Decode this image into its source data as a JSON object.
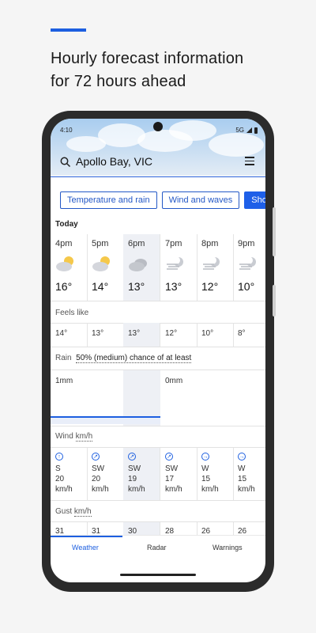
{
  "promo": {
    "headline_line1": "Hourly forecast information",
    "headline_line2": "for 72 hours ahead"
  },
  "status_bar": {
    "time": "4:10",
    "network": "5G"
  },
  "search": {
    "location": "Apollo Bay, VIC"
  },
  "chips": [
    {
      "label": "Temperature and rain"
    },
    {
      "label": "Wind and waves"
    },
    {
      "label": "Sho"
    }
  ],
  "day_label": "Today",
  "hours": [
    {
      "time": "4pm",
      "icon": "partly-sunny-icon",
      "temp": "16°"
    },
    {
      "time": "5pm",
      "icon": "partly-sunny-icon",
      "temp": "14°"
    },
    {
      "time": "6pm",
      "icon": "cloudy-icon",
      "temp": "13°"
    },
    {
      "time": "7pm",
      "icon": "hazy-moon-icon",
      "temp": "13°"
    },
    {
      "time": "8pm",
      "icon": "hazy-moon-icon",
      "temp": "12°"
    },
    {
      "time": "9pm",
      "icon": "hazy-moon-icon",
      "temp": "10°"
    }
  ],
  "feels_like": {
    "label": "Feels like",
    "values": [
      "14°",
      "13°",
      "13°",
      "12°",
      "10°",
      "8°"
    ]
  },
  "rain": {
    "label": "Rain",
    "chance": "50% (medium) chance of at least",
    "amount_first": "1mm",
    "amount_second": "0mm"
  },
  "wind": {
    "label": "Wind",
    "unit": "km/h",
    "cells": [
      {
        "dir": "S",
        "speed": "20",
        "unit": "km/h",
        "arrow": "↑"
      },
      {
        "dir": "SW",
        "speed": "20",
        "unit": "km/h",
        "arrow": "↗"
      },
      {
        "dir": "SW",
        "speed": "19",
        "unit": "km/h",
        "arrow": "↗"
      },
      {
        "dir": "SW",
        "speed": "17",
        "unit": "km/h",
        "arrow": "↗"
      },
      {
        "dir": "W",
        "speed": "15",
        "unit": "km/h",
        "arrow": "→"
      },
      {
        "dir": "W",
        "speed": "15",
        "unit": "km/h",
        "arrow": "→"
      }
    ]
  },
  "gust": {
    "label": "Gust",
    "unit": "km/h",
    "values": [
      "31",
      "31",
      "30",
      "28",
      "26",
      "26"
    ]
  },
  "nav": {
    "weather": "Weather",
    "radar": "Radar",
    "warnings": "Warnings"
  },
  "colors": {
    "accent": "#1d5fe0",
    "shaded": "#eef0f5"
  }
}
